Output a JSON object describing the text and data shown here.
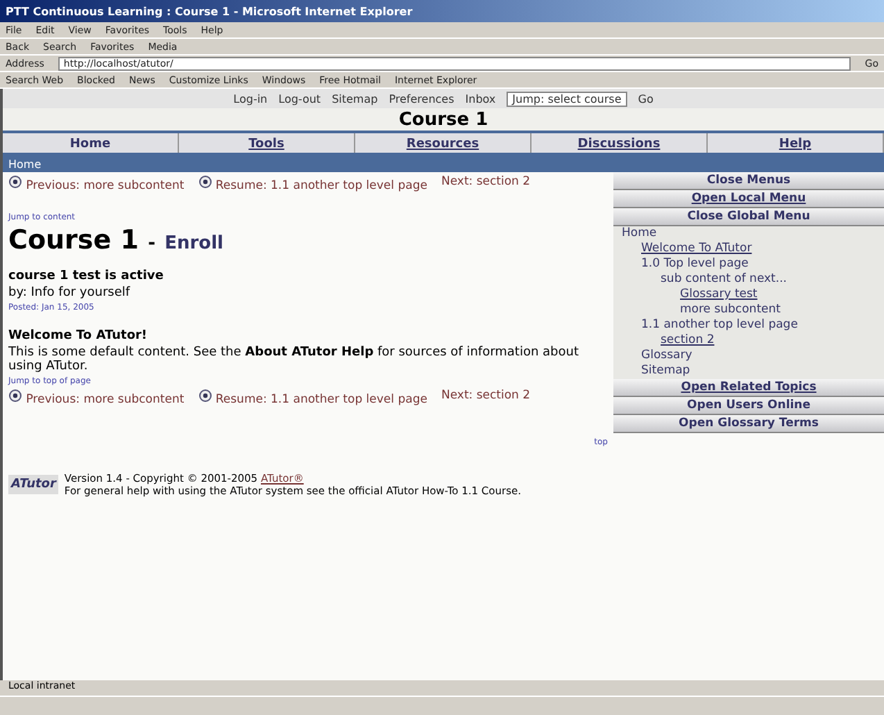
{
  "window": {
    "title": "PTT Continuous Learning : Course 1 - Microsoft Internet Explorer"
  },
  "menu_bar": [
    "File",
    "Edit",
    "View",
    "Favorites",
    "Tools",
    "Help"
  ],
  "toolbar": [
    "Back",
    "Search",
    "Favorites",
    "Media"
  ],
  "address_bar": {
    "label": "Address",
    "value": "http://localhost/atutor/",
    "go": "Go"
  },
  "links_bar": [
    "Search Web",
    "Blocked",
    "News",
    "Customize Links",
    "Windows",
    "Free Hotmail",
    "Internet Explorer"
  ],
  "user_bar": {
    "items": [
      "Log-in",
      "Log-out",
      "Sitemap",
      "Preferences",
      "Inbox"
    ],
    "jump": "Jump: select course",
    "go": "Go"
  },
  "course_title": "Course 1",
  "nav_tabs": [
    {
      "label": "Home",
      "selected": true
    },
    {
      "label": "Tools",
      "selected": false
    },
    {
      "label": "Resources",
      "selected": false
    },
    {
      "label": "Discussions",
      "selected": false
    },
    {
      "label": "Help",
      "selected": false
    }
  ],
  "breadcrumb": "Home",
  "sequence_top": {
    "previous": "Previous: more subcontent",
    "resume": "Resume: 1.1 another top level page",
    "next": "Next: section 2"
  },
  "jump_link": "Jump to content",
  "heading": {
    "title": "Course 1",
    "separator": "-",
    "link": "Enroll"
  },
  "announcement": {
    "title": "course 1 test is active",
    "body": "by: Info for yourself",
    "meta": "Posted: Jan 15, 2005"
  },
  "welcome": {
    "title": "Welcome To ATutor!",
    "body": "This is some default content. See the **About ATutor Help** for sources of information about using ATutor.",
    "meta": "Jump to top of page"
  },
  "sequence_bottom": {
    "previous": "Previous: more subcontent",
    "resume": "Resume: 1.1 another top level page",
    "next": "Next: section 2"
  },
  "top_link": "top",
  "footer": {
    "logo": "ATutor",
    "line1": "Version 1.4 - Copyright © 2001-2005",
    "link": "ATutor®",
    "line2": "For general help with using the ATutor system see the official ATutor How-To 1.1 Course."
  },
  "side_menu": {
    "top": [
      {
        "label": "Close Menus",
        "link": false
      },
      {
        "label": "Open Local Menu",
        "link": true
      },
      {
        "label": "Close Global Menu",
        "link": false
      }
    ],
    "tree_title": "Home",
    "tree": [
      {
        "label": "Welcome To ATutor",
        "link": true
      },
      {
        "label": "1.0 Top level page",
        "link": false,
        "children": [
          {
            "label": "sub content of next...",
            "link": false,
            "children": [
              {
                "label": "Glossary test",
                "link": true
              },
              {
                "label": "more subcontent",
                "link": false
              }
            ]
          }
        ]
      },
      {
        "label": "1.1 another top level page",
        "link": false,
        "children": [
          {
            "label": "section 2",
            "link": true
          }
        ]
      },
      {
        "label": "Glossary",
        "link": false
      },
      {
        "label": "Sitemap",
        "link": false
      }
    ],
    "bottom": [
      {
        "label": "Open Related Topics",
        "link": true
      },
      {
        "label": "Open Users Online",
        "link": false
      },
      {
        "label": "Open Glossary Terms",
        "link": false
      }
    ]
  },
  "status_bar": {
    "zone": "Local intranet"
  }
}
